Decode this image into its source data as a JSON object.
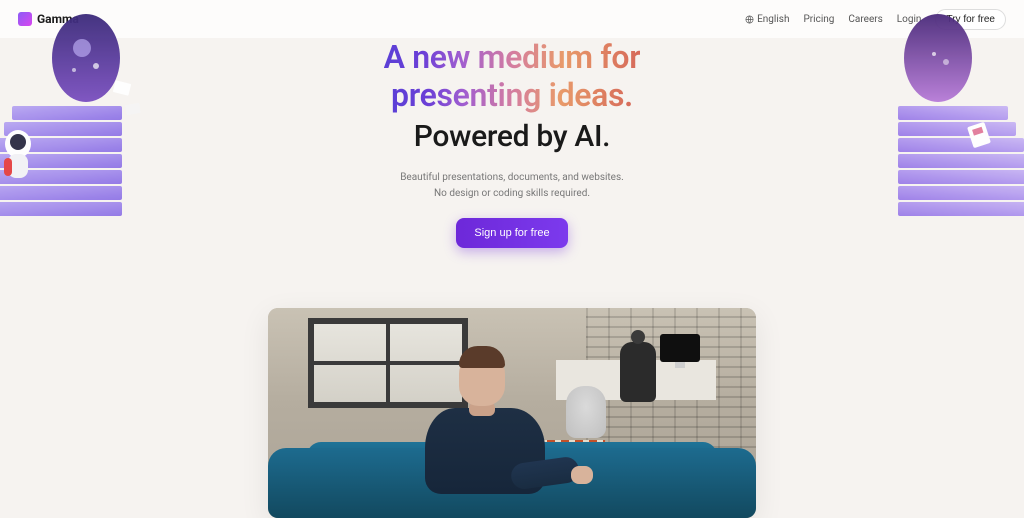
{
  "brand": {
    "name": "Gamma"
  },
  "nav": {
    "language": "English",
    "pricing": "Pricing",
    "careers": "Careers",
    "login": "Login",
    "try": "Try for free"
  },
  "hero": {
    "headline_line1": "A new medium for",
    "headline_line2": "presenting ideas.",
    "subhead": "Powered by AI.",
    "desc_line1": "Beautiful presentations, documents, and websites.",
    "desc_line2": "No design or coding skills required.",
    "cta": "Sign up for free"
  },
  "colors": {
    "cta_bg": "#6d28d9"
  }
}
